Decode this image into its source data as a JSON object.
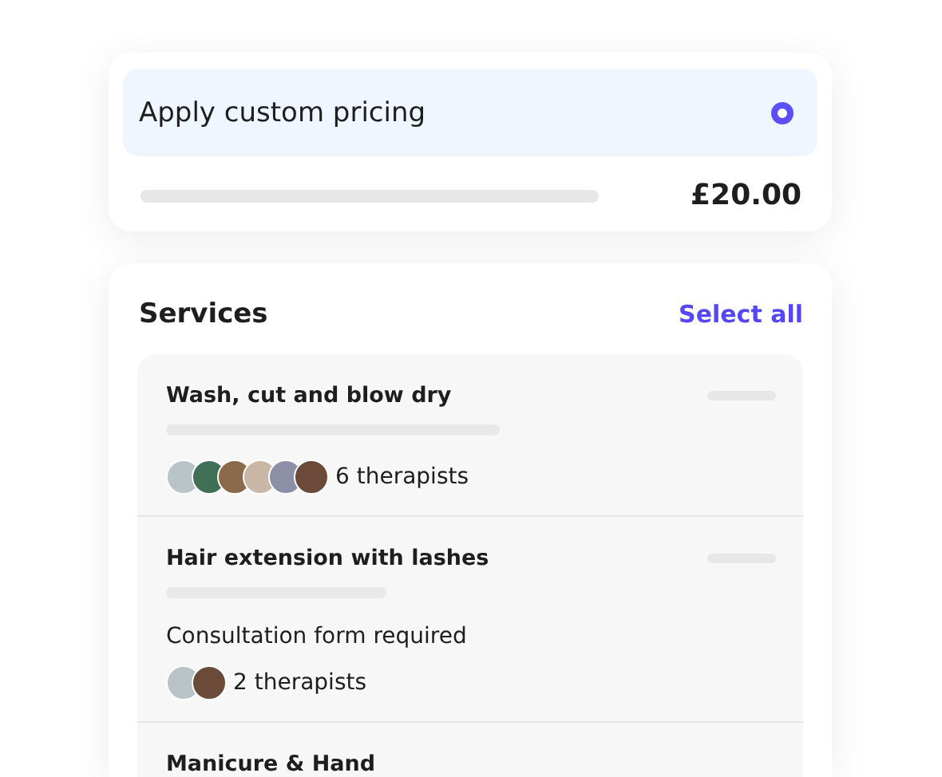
{
  "pricing": {
    "label": "Apply custom pricing",
    "selected": true,
    "price": "£20.00"
  },
  "services": {
    "title": "Services",
    "select_all": "Select all",
    "items": [
      {
        "name": "Wash, cut and blow dry",
        "avatars": [
          {
            "kind": "photo"
          },
          {
            "kind": "photo"
          },
          {
            "kind": "photo"
          },
          {
            "kind": "photo"
          },
          {
            "kind": "photo"
          },
          {
            "kind": "photo"
          }
        ],
        "therapists": "6 therapists"
      },
      {
        "name": "Hair extension with lashes",
        "note": "Consultation form required",
        "avatars": [
          {
            "kind": "photo"
          },
          {
            "kind": "photo"
          }
        ],
        "therapists": "2 therapists"
      },
      {
        "name": "Manicure & Hand"
      }
    ]
  }
}
